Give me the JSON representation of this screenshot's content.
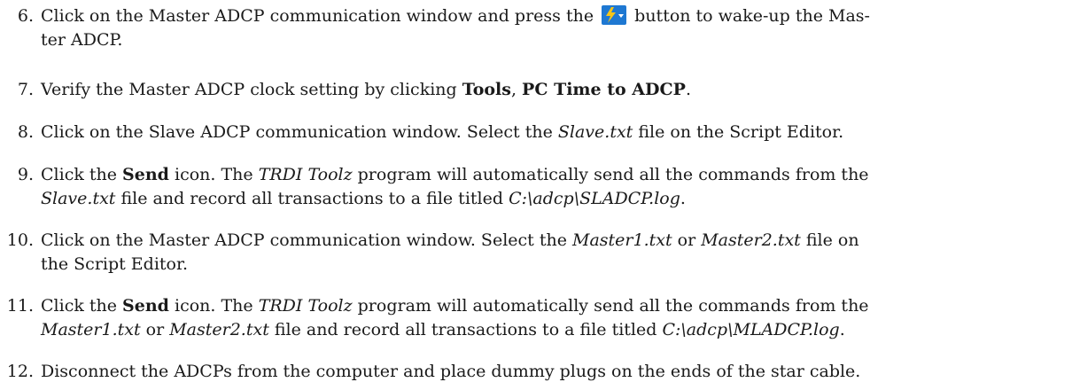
{
  "steps": [
    {
      "number": "6.",
      "text_before_icon": "Click on the Master ADCP communication window and press the",
      "icon": "wakeup-lightning-icon",
      "text_after_icon": "button to wake-up the Mas-",
      "line2": "ter ADCP."
    },
    {
      "number": "7.",
      "t1": "Verify the Master ADCP clock setting by clicking ",
      "b1": "Tools",
      "t2": ", ",
      "b2": "PC Time to ADCP",
      "t3": "."
    },
    {
      "number": "8.",
      "t1": "Click on the Slave ADCP communication window. Select the ",
      "i1": "Slave.txt",
      "t2": " file on the Script Editor."
    },
    {
      "number": "9.",
      "t1": "Click the ",
      "b1": "Send",
      "t2": " icon. The ",
      "i1": "TRDI Toolz",
      "t3": " program will automatically send all the commands from the",
      "i2": "Slave.txt",
      "t4": " file and record all transactions to a file titled ",
      "i3": "C:\\adcp\\SLADCP.log",
      "t5": "."
    },
    {
      "number": "10.",
      "t1": "Click on the Master ADCP communication window. Select the ",
      "i1": "Master1.txt",
      "t2": " or ",
      "i2": "Master2.txt",
      "t3": " file on",
      "t4": "the Script Editor."
    },
    {
      "number": "11.",
      "t1": "Click the ",
      "b1": "Send",
      "t2": " icon. The ",
      "i1": "TRDI Toolz",
      "t3": " program will automatically send all the commands from the",
      "i2": "Master1.txt",
      "t4": " or ",
      "i3": "Master2.txt",
      "t5": " file and record all transactions to a file titled ",
      "i4": "C:\\adcp\\MLADCP.log",
      "t6": "."
    },
    {
      "number": "12.",
      "t1": "Disconnect the ADCPs from the computer and place dummy plugs on the ends of the star cable."
    }
  ],
  "colors": {
    "icon_background": "#1e78d2",
    "icon_bolt": "#f5c518",
    "text": "#1a1a1a"
  }
}
